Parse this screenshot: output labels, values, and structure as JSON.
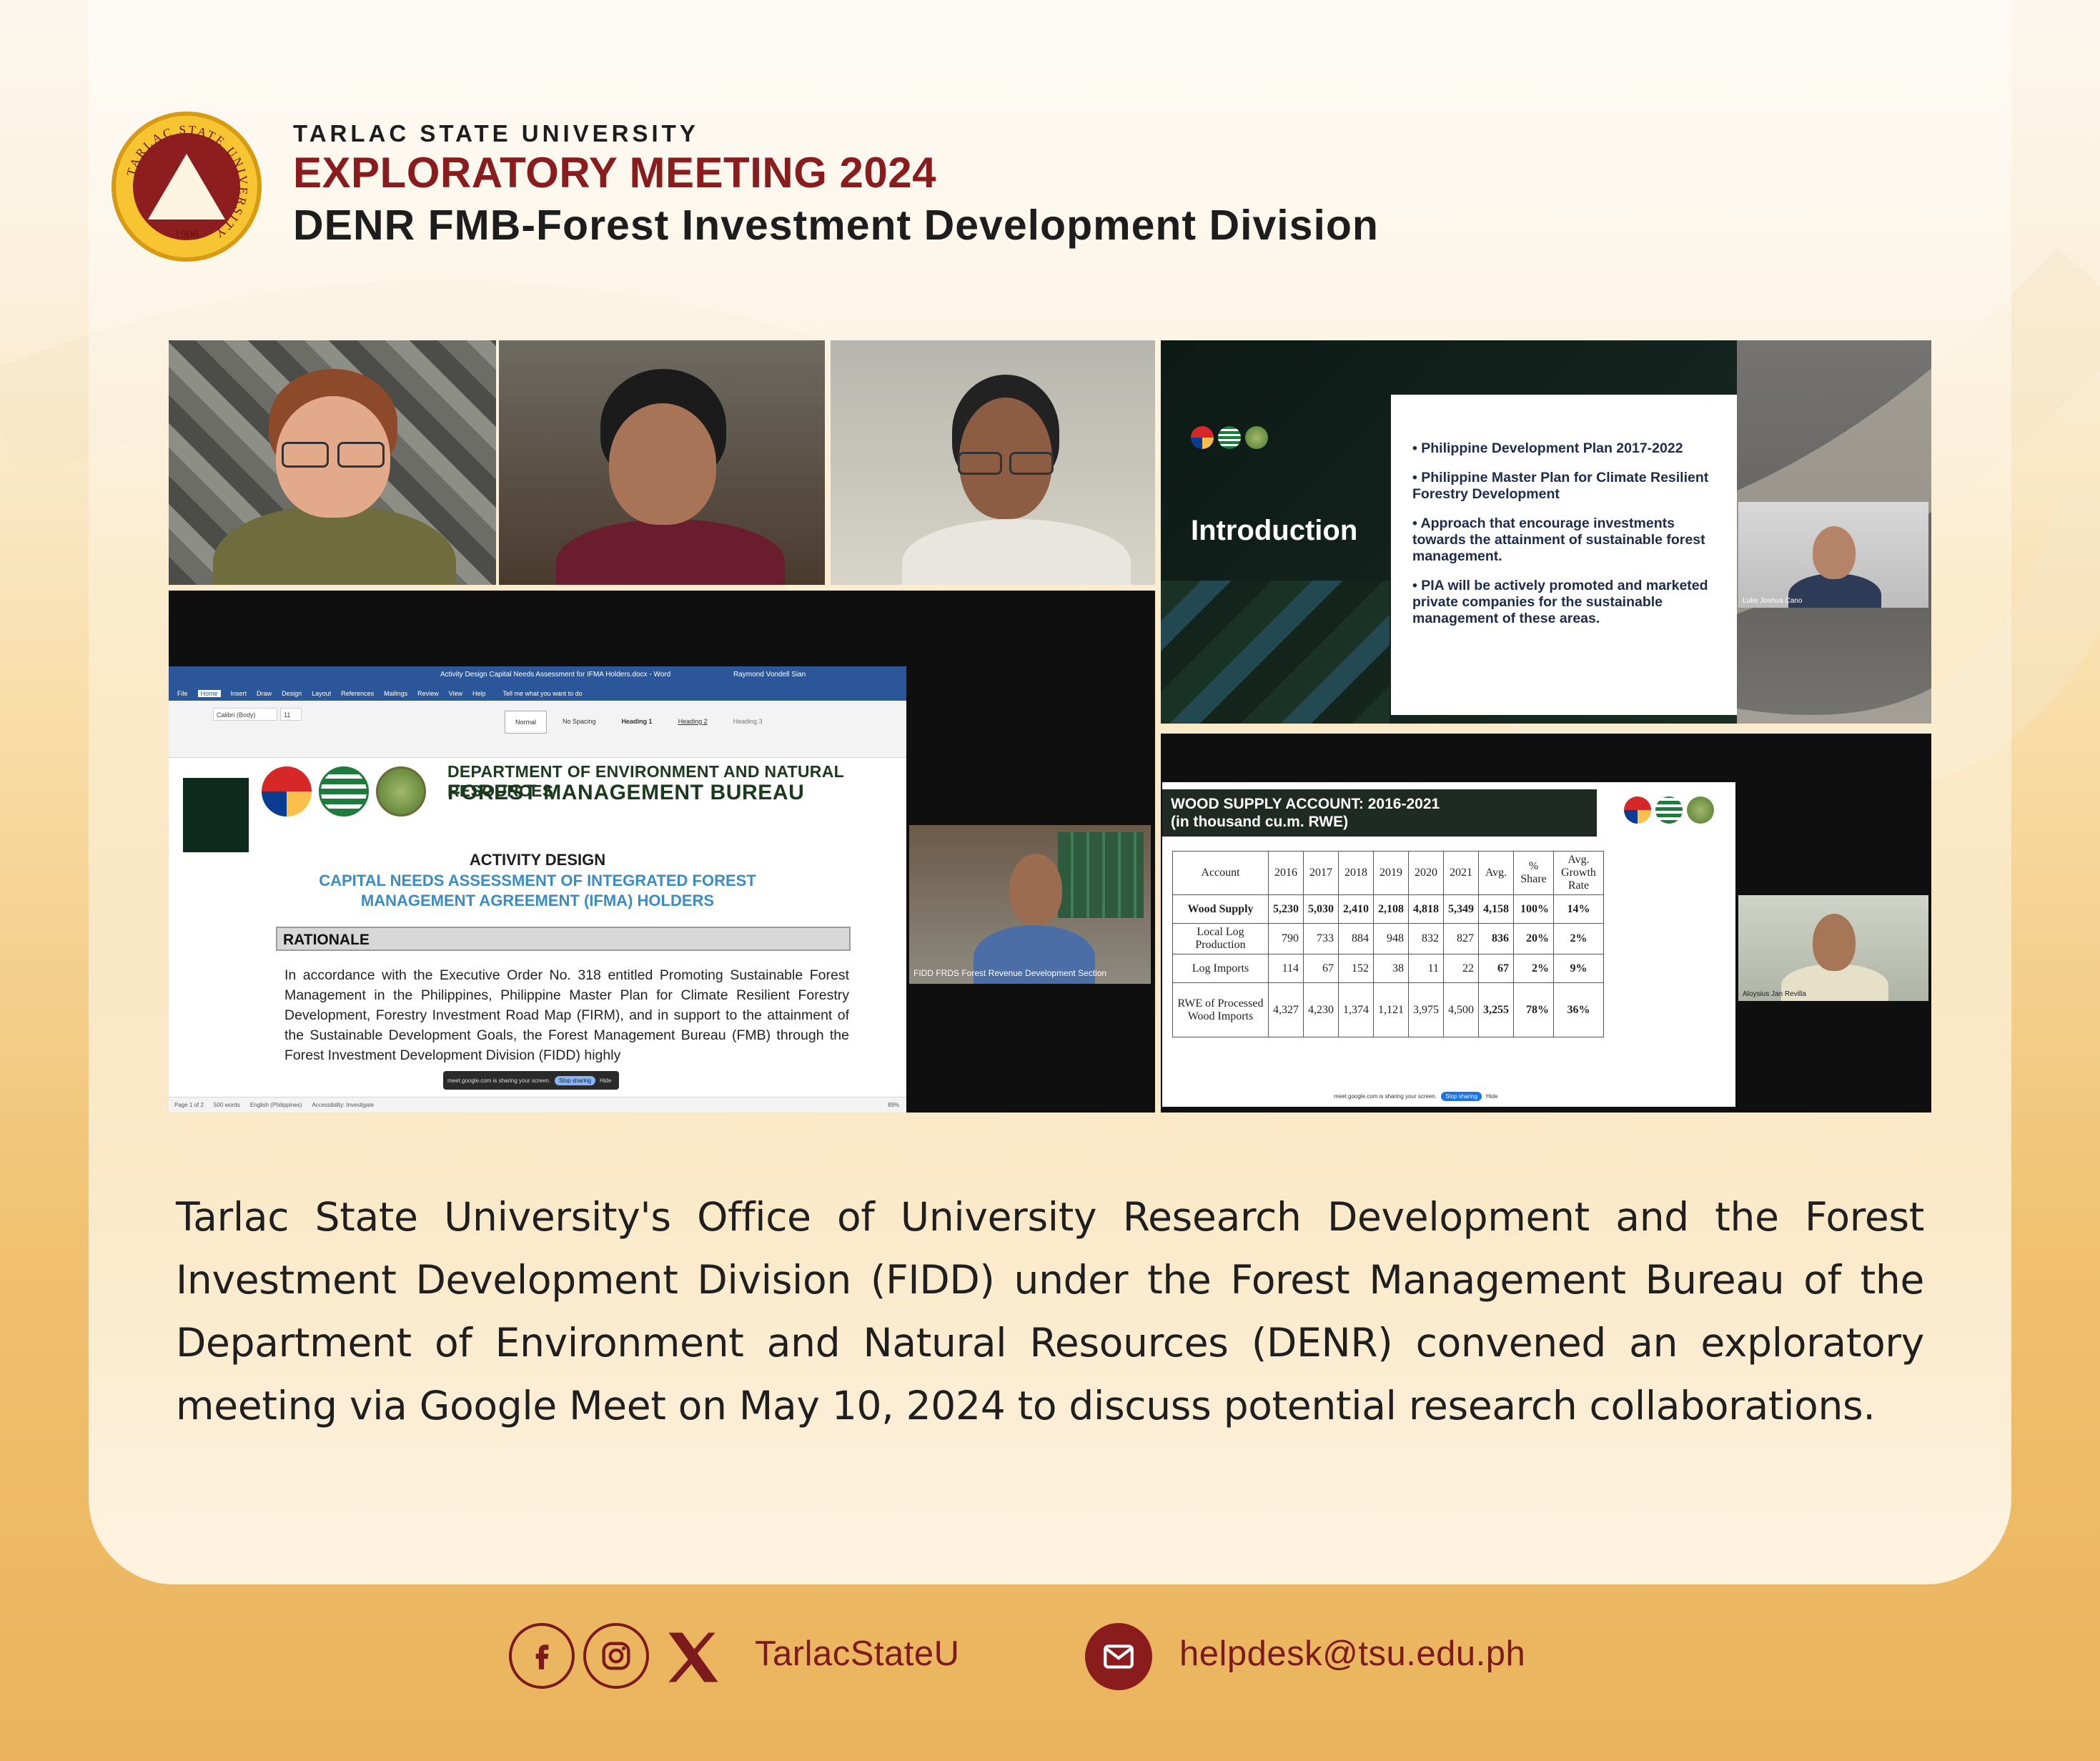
{
  "header": {
    "university": "TARLAC STATE UNIVERSITY",
    "title": "EXPLORATORY MEETING 2024",
    "subtitle": "DENR FMB-Forest Investment Development Division",
    "seal_ring_text": "TARLAC STATE UNIVERSITY",
    "seal_year": "1906"
  },
  "meeting": {
    "word_doc": {
      "window_title": "Activity Design Capital Needs Assessment for IFMA Holders.docx - Word",
      "user": "Raymond Vondell Sian",
      "tabs": [
        "File",
        "Home",
        "Insert",
        "Draw",
        "Design",
        "Layout",
        "References",
        "Mailings",
        "Review",
        "View",
        "Help"
      ],
      "search_hint": "Tell me what you want to do",
      "styles": [
        "Normal",
        "No Spacing",
        "Heading 1",
        "Heading 2",
        "Heading 3"
      ],
      "font": "Calibri (Body)",
      "font_size": "11",
      "org_line1": "DEPARTMENT OF ENVIRONMENT AND NATURAL RESOURCES",
      "org_line2": "FOREST MANAGEMENT BUREAU",
      "doc_heading": "ACTIVITY DESIGN",
      "doc_title": "CAPITAL NEEDS ASSESSMENT OF INTEGRATED FOREST MANAGEMENT AGREEMENT (IFMA) HOLDERS",
      "section": "RATIONALE",
      "body": "In accordance with the Executive Order No. 318 entitled Promoting Sustainable Forest Management in the Philippines, Philippine Master Plan for Climate Resilient Forestry Development, Forestry Investment Road Map (FIRM), and in support to the attainment of the Sustainable Development Goals, the Forest Management Bureau (FMB) through the Forest Investment Development Division (FIDD) highly",
      "status_left": "Page 1 of 2",
      "status_words": "500 words",
      "status_lang": "English (Philippines)",
      "status_access": "Accessibility: Investigate",
      "share_notice": "meet.google.com is sharing your screen.",
      "stop_sharing": "Stop sharing",
      "hide": "Hide",
      "zoom": "89%"
    },
    "presenter_label": "FIDD FRDS Forest Revenue Development Section",
    "intro_slide": {
      "title": "Introduction",
      "bullets": [
        "Philippine Development Plan 2017-2022",
        "Philippine Master Plan for Climate Resilient Forestry Development",
        "Approach that encourage investments towards the attainment of sustainable forest management.",
        "PIA will be actively promoted and marketed private companies for the sustainable management of these areas."
      ],
      "participant": "Luke Joshua Cano"
    },
    "wood_slide": {
      "title_line1": "WOOD SUPPLY ACCOUNT: 2016-2021",
      "title_line2": "(in thousand cu.m. RWE)",
      "columns": [
        "Account",
        "2016",
        "2017",
        "2018",
        "2019",
        "2020",
        "2021",
        "Avg.",
        "% Share",
        "Avg. Growth Rate"
      ],
      "rows": [
        [
          "Wood Supply",
          "5,230",
          "5,030",
          "2,410",
          "2,108",
          "4,818",
          "5,349",
          "4,158",
          "100%",
          "14%"
        ],
        [
          "Local Log Production",
          "790",
          "733",
          "884",
          "948",
          "832",
          "827",
          "836",
          "20%",
          "2%"
        ],
        [
          "Log Imports",
          "114",
          "67",
          "152",
          "38",
          "11",
          "22",
          "67",
          "2%",
          "9%"
        ],
        [
          "RWE of Processed Wood Imports",
          "4,327",
          "4,230",
          "1,374",
          "1,121",
          "3,975",
          "4,500",
          "3,255",
          "78%",
          "36%"
        ]
      ],
      "participant": "Aloysius Jan Revilla",
      "share_notice": "meet.google.com is sharing your screen.",
      "stop_sharing": "Stop sharing",
      "hide": "Hide"
    }
  },
  "body_text": "Tarlac State University's Office of University Research Development and the Forest Investment Development Division (FIDD) under the Forest Management Bureau of the Department of Environment and Natural Resources (DENR) convened an exploratory meeting via Google Meet on May 10, 2024 to discuss potential research collaborations.",
  "footer": {
    "social_handle": "TarlacStateU",
    "email": "helpdesk@tsu.edu.ph",
    "icons": [
      "facebook-icon",
      "instagram-icon",
      "x-icon",
      "mail-icon"
    ]
  },
  "colors": {
    "brand_maroon": "#8b1c1d",
    "seal_gold": "#f6c531",
    "background_top": "#fcf7ee",
    "background_bottom": "#eab35c"
  }
}
